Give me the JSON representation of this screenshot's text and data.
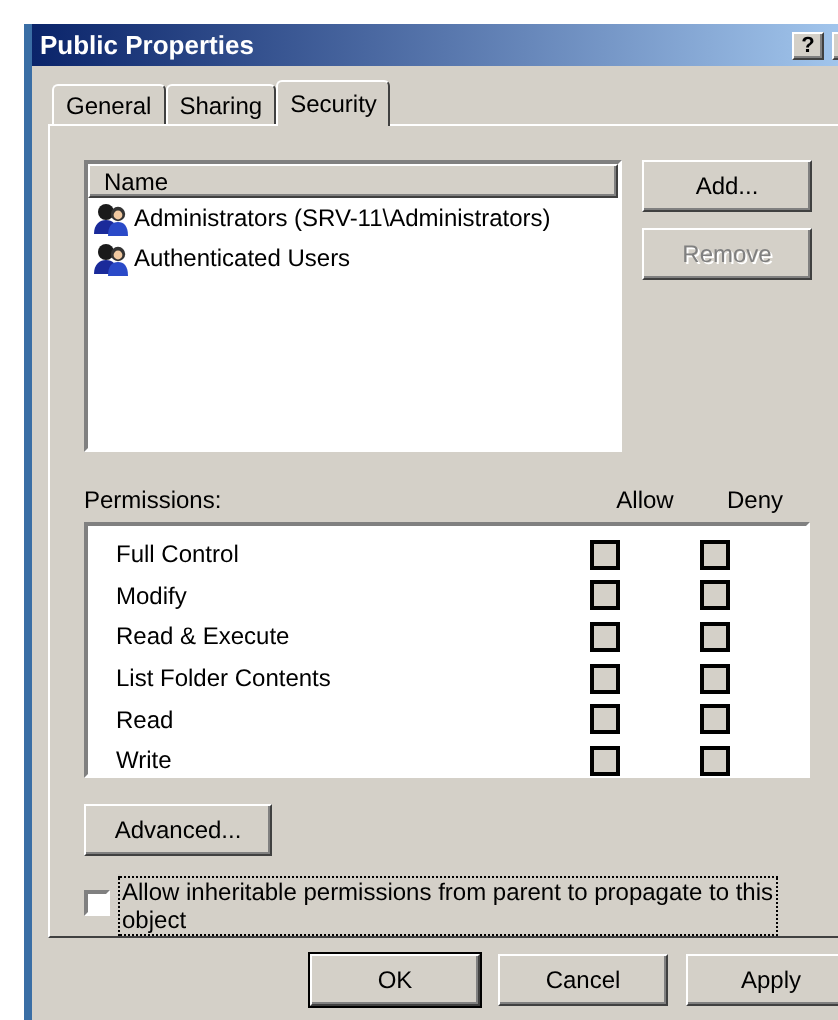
{
  "window": {
    "title": "Public Properties",
    "help": "?"
  },
  "tabs": [
    {
      "label": "General",
      "selected": false
    },
    {
      "label": "Sharing",
      "selected": false
    },
    {
      "label": "Security",
      "selected": true
    }
  ],
  "users": {
    "column": "Name",
    "items": [
      {
        "name": "Administrators (SRV-11\\Administrators)"
      },
      {
        "name": "Authenticated Users"
      }
    ]
  },
  "side_buttons": [
    {
      "label": "Add...",
      "disabled": false
    },
    {
      "label": "Remove",
      "disabled": true
    }
  ],
  "permissions": {
    "label": "Permissions:",
    "allow_header": "Allow",
    "deny_header": "Deny",
    "rows": [
      {
        "name": "Full Control",
        "allow": false,
        "deny": false,
        "disabled": true
      },
      {
        "name": "Modify",
        "allow": false,
        "deny": false,
        "disabled": true
      },
      {
        "name": "Read & Execute",
        "allow": false,
        "deny": false,
        "disabled": true
      },
      {
        "name": "List Folder Contents",
        "allow": false,
        "deny": false,
        "disabled": true
      },
      {
        "name": "Read",
        "allow": false,
        "deny": false,
        "disabled": true
      },
      {
        "name": "Write",
        "allow": false,
        "deny": false,
        "disabled": true
      }
    ]
  },
  "advanced": "Advanced...",
  "inherit": {
    "label": "Allow inheritable permissions from parent to propagate to this object",
    "checked": false,
    "focused": true
  },
  "dialog_buttons": [
    {
      "label": "OK",
      "default": true
    },
    {
      "label": "Cancel",
      "default": false
    },
    {
      "label": "Apply",
      "default": false
    }
  ]
}
